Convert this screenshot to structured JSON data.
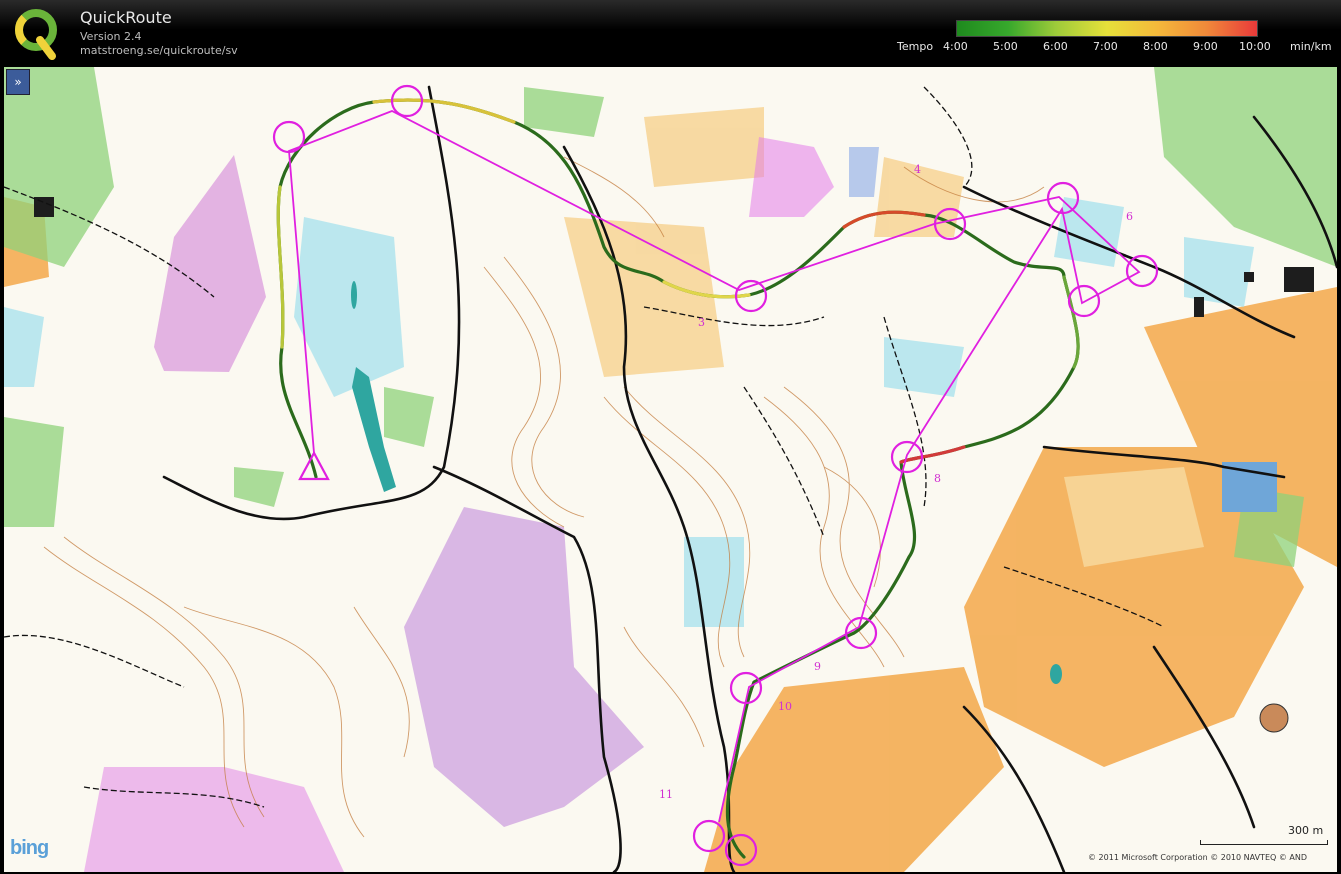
{
  "app": {
    "title": "QuickRoute",
    "version": "Version 2.4",
    "url": "matstroeng.se/quickroute/sv"
  },
  "legend": {
    "label": "Tempo",
    "ticks": [
      "4:00",
      "5:00",
      "6:00",
      "7:00",
      "8:00",
      "9:00",
      "10:00"
    ],
    "unit": "min/km",
    "colors": {
      "fast": "#1e8a1e",
      "medium": "#e6e03a",
      "slow": "#e83a3a"
    }
  },
  "map": {
    "expand_label": "»",
    "provider_logo": "bing",
    "scale_label": "300 m",
    "copyright": "© 2011 Microsoft Corporation   © 2010 NAVTEQ   © AND",
    "control_numbers": [
      "3",
      "4",
      "6",
      "8",
      "9",
      "10",
      "11"
    ],
    "course_color": "#e020e0",
    "route_color": "#2b6b1c"
  }
}
